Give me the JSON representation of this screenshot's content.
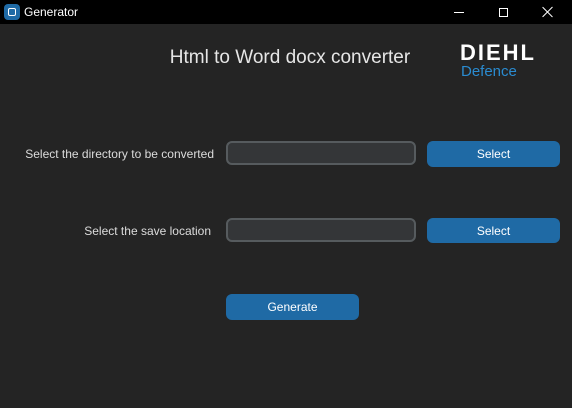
{
  "window": {
    "title": "Generator",
    "controls": [
      "minimize-icon",
      "maximize-icon",
      "close-icon"
    ]
  },
  "header": {
    "title": "Html to Word docx converter",
    "logo": {
      "main": "DIEHL",
      "sub": "Defence"
    }
  },
  "form": {
    "directory": {
      "label": "Select the directory to be converted",
      "value": "",
      "button_label": "Select"
    },
    "save_location": {
      "label": "Select the save location",
      "value": "",
      "button_label": "Select"
    },
    "generate_label": "Generate"
  },
  "colors": {
    "background": "#242424",
    "titlebar": "#000000",
    "accent": "#1f6aa5",
    "logo_sub": "#2a8bd0",
    "entry_background": "#343638",
    "entry_border": "#565b5e"
  }
}
